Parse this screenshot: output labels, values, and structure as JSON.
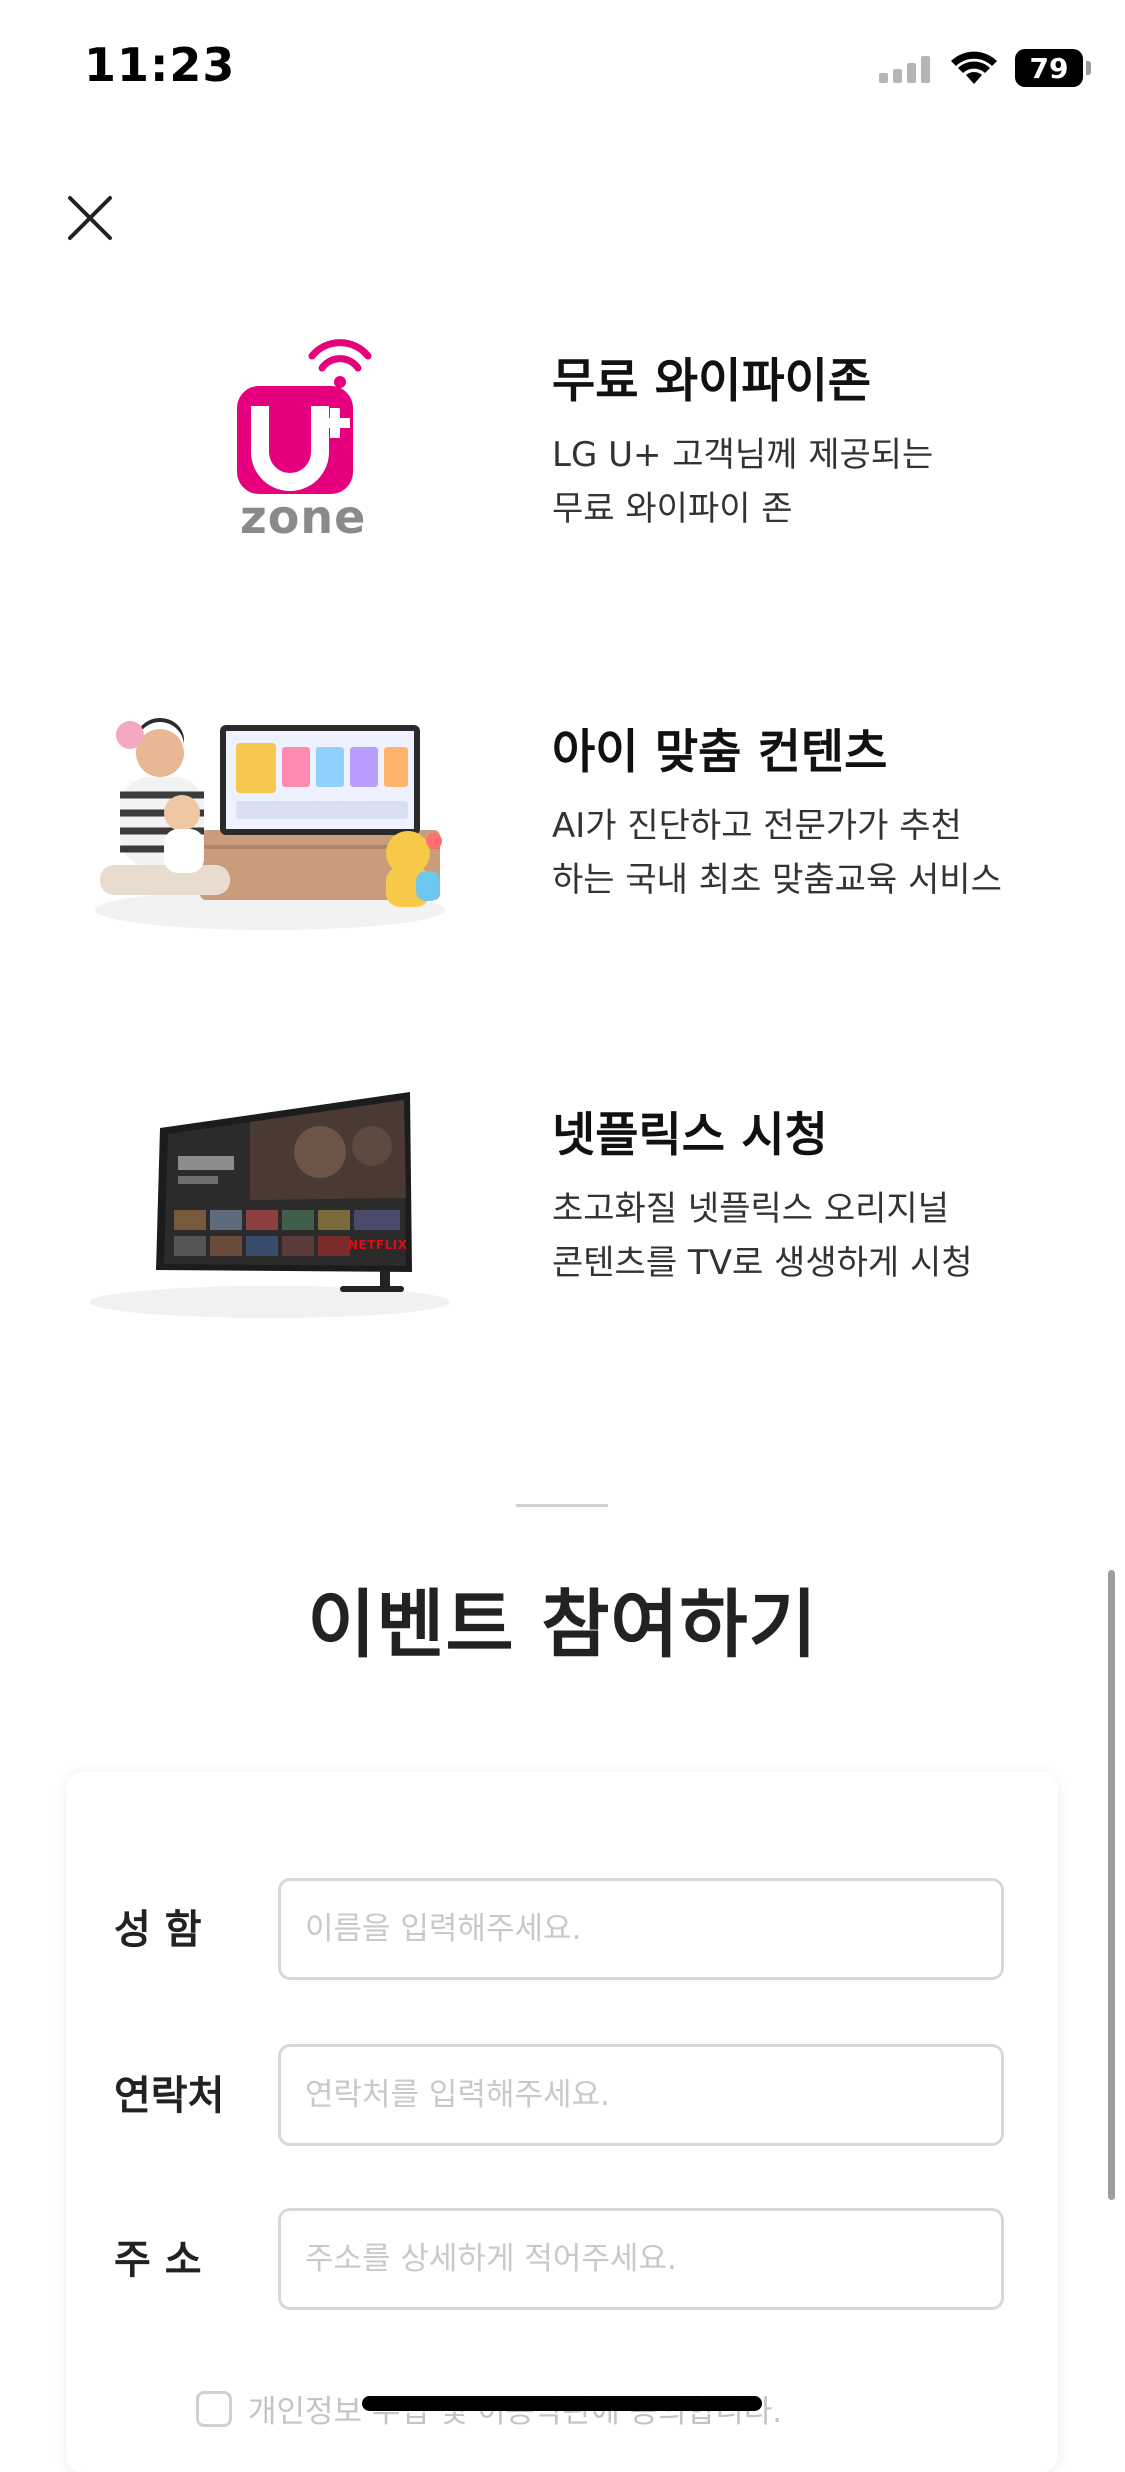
{
  "status_bar": {
    "time": "11:23",
    "battery": "79"
  },
  "features": [
    {
      "title": "무료 와이파이존",
      "desc": [
        "LG U+ 고객님께 제공되는",
        "무료 와이파이 존"
      ],
      "thumb_icon": "uplus-zone-wifi-logo",
      "logo_text": "U+ zone"
    },
    {
      "title": "아이 맞춤 컨텐츠",
      "desc": [
        "AI가 진단하고 전문가가 추천",
        "하는 국내 최초 맞춤교육 서비스"
      ],
      "thumb_icon": "parent-child-tv-illustration"
    },
    {
      "title": "넷플릭스 시청",
      "desc": [
        "초고화질 넷플릭스 오리지널",
        "콘텐츠를 TV로 생생하게 시청"
      ],
      "thumb_icon": "netflix-tv-illustration",
      "tv_badge": "NETFLIX"
    }
  ],
  "event": {
    "title": "이벤트 참여하기",
    "fields": [
      {
        "label": "성 함",
        "placeholder": "이름을 입력해주세요."
      },
      {
        "label": "연락처",
        "placeholder": "연락처를 입력해주세요."
      },
      {
        "label": "주 소",
        "placeholder": "주소를 상세하게 적어주세요."
      }
    ],
    "agree_text": "개인정보 수집 및 이용약관에 동의합니다."
  },
  "colors": {
    "brand_magenta": "#e6007e",
    "text_dark": "#111111",
    "placeholder": "#c9c9c9"
  }
}
